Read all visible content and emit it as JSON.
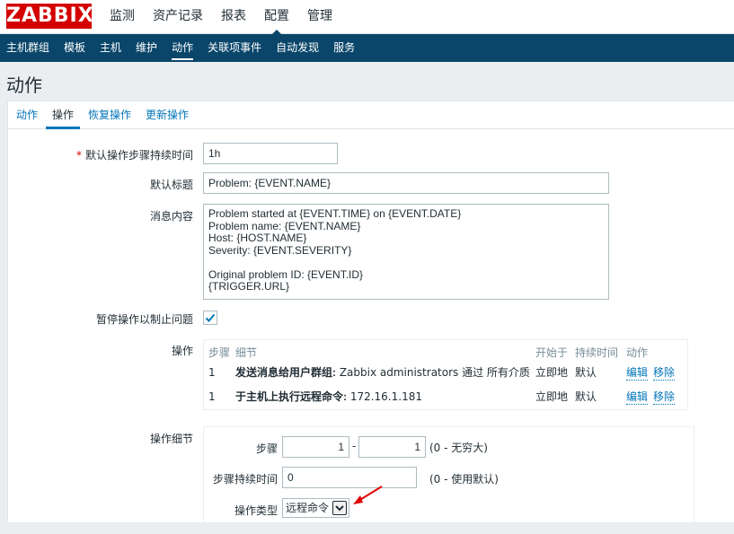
{
  "header": {
    "logo": "ZABBIX",
    "nav": [
      "监测",
      "资产记录",
      "报表",
      "配置",
      "管理"
    ],
    "nav_selected": "配置"
  },
  "subnav": {
    "items": [
      "主机群组",
      "模板",
      "主机",
      "维护",
      "动作",
      "关联项事件",
      "自动发现",
      "服务"
    ],
    "selected": "动作"
  },
  "page_title": "动作",
  "tabs": {
    "items": [
      "动作",
      "操作",
      "恢复操作",
      "更新操作"
    ],
    "active": "操作"
  },
  "form": {
    "step_duration": {
      "required_mark": "*",
      "label": "默认操作步骤持续时间",
      "value": "1h"
    },
    "subject": {
      "label": "默认标题",
      "value": "Problem: {EVENT.NAME}"
    },
    "message": {
      "label": "消息内容",
      "value": "Problem started at {EVENT.TIME} on {EVENT.DATE}\nProblem name: {EVENT.NAME}\nHost: {HOST.NAME}\nSeverity: {EVENT.SEVERITY}\n\nOriginal problem ID: {EVENT.ID}\n{TRIGGER.URL}"
    },
    "pause": {
      "label": "暂停操作以制止问题",
      "checked": true
    },
    "operations": {
      "label": "操作",
      "columns": [
        "步骤",
        "细节",
        "开始于",
        "持续时间",
        "动作"
      ],
      "rows": [
        {
          "step": "1",
          "detail_bold": "发送消息给用户群组:",
          "detail_rest": " Zabbix administrators 通过 所有介质",
          "start": "立即地",
          "duration": "默认",
          "edit": "编辑",
          "remove": "移除"
        },
        {
          "step": "1",
          "detail_bold": "于主机上执行远程命令:",
          "detail_rest": " 172.16.1.181",
          "start": "立即地",
          "duration": "默认",
          "edit": "编辑",
          "remove": "移除"
        }
      ]
    },
    "operation_details": {
      "label": "操作细节",
      "steps": {
        "label": "步骤",
        "from": "1",
        "separator": "-",
        "to": "1",
        "hint": "(0 - 无穷大)"
      },
      "step_duration": {
        "label": "步骤持续时间",
        "value": "0",
        "hint": "(0 - 使用默认)"
      },
      "operation_type": {
        "label": "操作类型",
        "value": "远程命令"
      }
    }
  },
  "colors": {
    "brand": "#d40000",
    "navbar": "#0a466a",
    "link": "#0275b8",
    "annotation_arrow": "#e00000"
  }
}
